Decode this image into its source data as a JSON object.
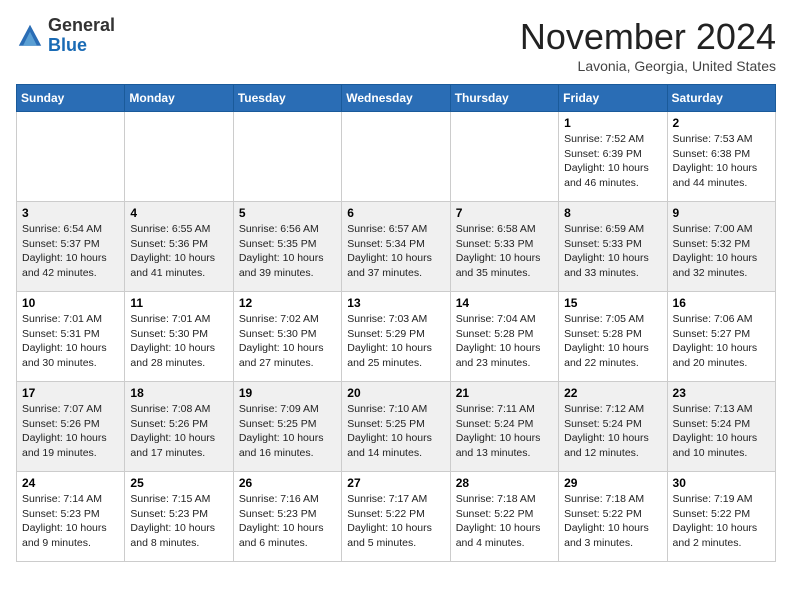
{
  "header": {
    "logo": {
      "line1": "General",
      "line2": "Blue"
    },
    "title": "November 2024",
    "subtitle": "Lavonia, Georgia, United States"
  },
  "weekdays": [
    "Sunday",
    "Monday",
    "Tuesday",
    "Wednesday",
    "Thursday",
    "Friday",
    "Saturday"
  ],
  "weeks": [
    [
      {
        "day": "",
        "info": ""
      },
      {
        "day": "",
        "info": ""
      },
      {
        "day": "",
        "info": ""
      },
      {
        "day": "",
        "info": ""
      },
      {
        "day": "",
        "info": ""
      },
      {
        "day": "1",
        "info": "Sunrise: 7:52 AM\nSunset: 6:39 PM\nDaylight: 10 hours and 46 minutes."
      },
      {
        "day": "2",
        "info": "Sunrise: 7:53 AM\nSunset: 6:38 PM\nDaylight: 10 hours and 44 minutes."
      }
    ],
    [
      {
        "day": "3",
        "info": "Sunrise: 6:54 AM\nSunset: 5:37 PM\nDaylight: 10 hours and 42 minutes."
      },
      {
        "day": "4",
        "info": "Sunrise: 6:55 AM\nSunset: 5:36 PM\nDaylight: 10 hours and 41 minutes."
      },
      {
        "day": "5",
        "info": "Sunrise: 6:56 AM\nSunset: 5:35 PM\nDaylight: 10 hours and 39 minutes."
      },
      {
        "day": "6",
        "info": "Sunrise: 6:57 AM\nSunset: 5:34 PM\nDaylight: 10 hours and 37 minutes."
      },
      {
        "day": "7",
        "info": "Sunrise: 6:58 AM\nSunset: 5:33 PM\nDaylight: 10 hours and 35 minutes."
      },
      {
        "day": "8",
        "info": "Sunrise: 6:59 AM\nSunset: 5:33 PM\nDaylight: 10 hours and 33 minutes."
      },
      {
        "day": "9",
        "info": "Sunrise: 7:00 AM\nSunset: 5:32 PM\nDaylight: 10 hours and 32 minutes."
      }
    ],
    [
      {
        "day": "10",
        "info": "Sunrise: 7:01 AM\nSunset: 5:31 PM\nDaylight: 10 hours and 30 minutes."
      },
      {
        "day": "11",
        "info": "Sunrise: 7:01 AM\nSunset: 5:30 PM\nDaylight: 10 hours and 28 minutes."
      },
      {
        "day": "12",
        "info": "Sunrise: 7:02 AM\nSunset: 5:30 PM\nDaylight: 10 hours and 27 minutes."
      },
      {
        "day": "13",
        "info": "Sunrise: 7:03 AM\nSunset: 5:29 PM\nDaylight: 10 hours and 25 minutes."
      },
      {
        "day": "14",
        "info": "Sunrise: 7:04 AM\nSunset: 5:28 PM\nDaylight: 10 hours and 23 minutes."
      },
      {
        "day": "15",
        "info": "Sunrise: 7:05 AM\nSunset: 5:28 PM\nDaylight: 10 hours and 22 minutes."
      },
      {
        "day": "16",
        "info": "Sunrise: 7:06 AM\nSunset: 5:27 PM\nDaylight: 10 hours and 20 minutes."
      }
    ],
    [
      {
        "day": "17",
        "info": "Sunrise: 7:07 AM\nSunset: 5:26 PM\nDaylight: 10 hours and 19 minutes."
      },
      {
        "day": "18",
        "info": "Sunrise: 7:08 AM\nSunset: 5:26 PM\nDaylight: 10 hours and 17 minutes."
      },
      {
        "day": "19",
        "info": "Sunrise: 7:09 AM\nSunset: 5:25 PM\nDaylight: 10 hours and 16 minutes."
      },
      {
        "day": "20",
        "info": "Sunrise: 7:10 AM\nSunset: 5:25 PM\nDaylight: 10 hours and 14 minutes."
      },
      {
        "day": "21",
        "info": "Sunrise: 7:11 AM\nSunset: 5:24 PM\nDaylight: 10 hours and 13 minutes."
      },
      {
        "day": "22",
        "info": "Sunrise: 7:12 AM\nSunset: 5:24 PM\nDaylight: 10 hours and 12 minutes."
      },
      {
        "day": "23",
        "info": "Sunrise: 7:13 AM\nSunset: 5:24 PM\nDaylight: 10 hours and 10 minutes."
      }
    ],
    [
      {
        "day": "24",
        "info": "Sunrise: 7:14 AM\nSunset: 5:23 PM\nDaylight: 10 hours and 9 minutes."
      },
      {
        "day": "25",
        "info": "Sunrise: 7:15 AM\nSunset: 5:23 PM\nDaylight: 10 hours and 8 minutes."
      },
      {
        "day": "26",
        "info": "Sunrise: 7:16 AM\nSunset: 5:23 PM\nDaylight: 10 hours and 6 minutes."
      },
      {
        "day": "27",
        "info": "Sunrise: 7:17 AM\nSunset: 5:22 PM\nDaylight: 10 hours and 5 minutes."
      },
      {
        "day": "28",
        "info": "Sunrise: 7:18 AM\nSunset: 5:22 PM\nDaylight: 10 hours and 4 minutes."
      },
      {
        "day": "29",
        "info": "Sunrise: 7:18 AM\nSunset: 5:22 PM\nDaylight: 10 hours and 3 minutes."
      },
      {
        "day": "30",
        "info": "Sunrise: 7:19 AM\nSunset: 5:22 PM\nDaylight: 10 hours and 2 minutes."
      }
    ]
  ]
}
